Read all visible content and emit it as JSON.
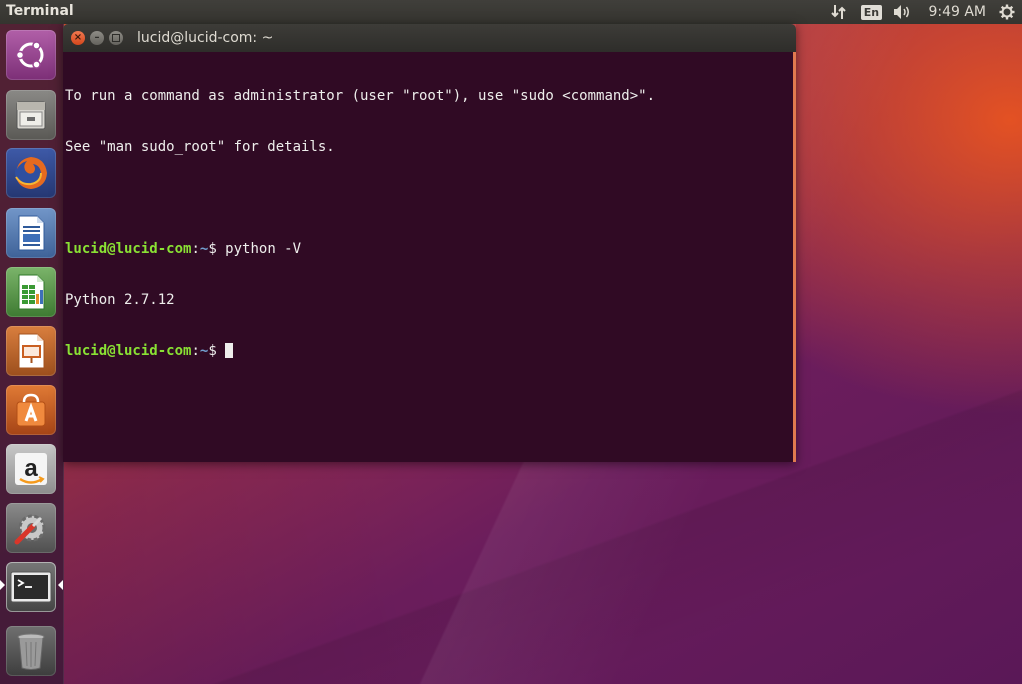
{
  "top_panel": {
    "app_title": "Terminal",
    "keyboard_layout": "En",
    "clock": "9:49 AM"
  },
  "launcher": {
    "items": [
      {
        "icon": "ubuntu-dash-icon"
      },
      {
        "icon": "files-icon"
      },
      {
        "icon": "firefox-icon"
      },
      {
        "icon": "libreoffice-writer-icon"
      },
      {
        "icon": "libreoffice-calc-icon"
      },
      {
        "icon": "libreoffice-impress-icon"
      },
      {
        "icon": "software-center-icon"
      },
      {
        "icon": "amazon-icon"
      },
      {
        "icon": "system-settings-icon"
      },
      {
        "icon": "terminal-icon",
        "running": true
      },
      {
        "icon": "trash-icon"
      }
    ]
  },
  "terminal": {
    "title": "lucid@lucid-com: ~",
    "lines": {
      "l1": "To run a command as administrator (user \"root\"), use \"sudo <command>\".",
      "l2": "See \"man sudo_root\" for details.",
      "prompt_user": "lucid@lucid-com",
      "prompt_sep": ":",
      "prompt_path": "~",
      "prompt_end": "$ ",
      "cmd1": "python -V",
      "out1": "Python 2.7.12"
    }
  },
  "colors": {
    "terminal_bg": "#300a24",
    "prompt_user": "#8ae234",
    "prompt_path": "#729fcf",
    "close_button": "#e9541f"
  }
}
